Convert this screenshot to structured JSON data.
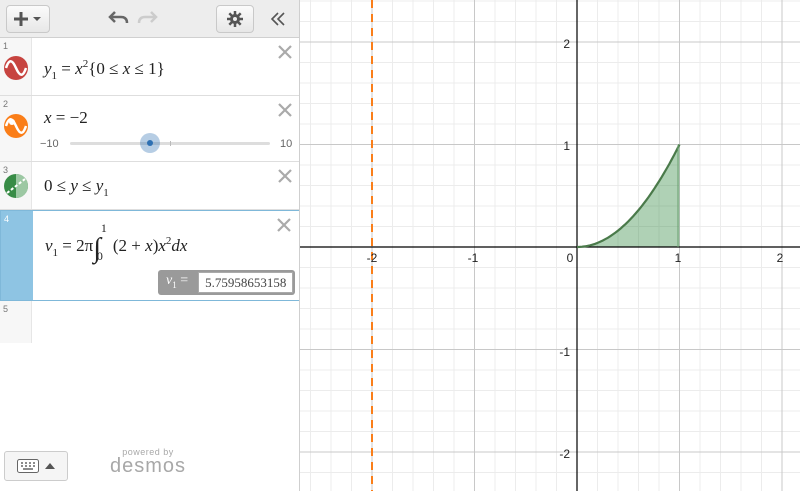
{
  "toolbar": {
    "add_icon": "plus-dropdown-icon",
    "undo_icon": "undo-icon",
    "redo_icon": "redo-icon",
    "settings_icon": "gear-icon",
    "collapse_icon": "double-chevron-left-icon"
  },
  "expressions": [
    {
      "num": "1",
      "color": "#c74440",
      "icon": "wave-icon"
    },
    {
      "num": "2",
      "color": "#fa7e19",
      "icon": "slider-play-icon",
      "slider": {
        "min": "−10",
        "max": "10",
        "value": -2,
        "fraction": 0.4
      }
    },
    {
      "num": "3",
      "color": "#388c46",
      "icon": "inequality-icon"
    },
    {
      "num": "4",
      "eval_label": "v",
      "eval_sub": "1",
      "eval_eq": "=",
      "eval_value": "5.75958653158"
    },
    {
      "num": "5"
    }
  ],
  "math": {
    "e1": {
      "y": "y",
      "sub": "1",
      "eq": " = ",
      "x": "x",
      "exp": "2",
      "open": "{0 ≤ ",
      "x2": "x",
      "close": " ≤ 1}"
    },
    "e2": {
      "x": "x",
      "rest": " = −2"
    },
    "e3": {
      "a": "0 ≤ ",
      "y": "y",
      "mid": " ≤ ",
      "y1": "y",
      "sub": "1"
    },
    "e4": {
      "v": "v",
      "sub": "1",
      "eq": " = 2π",
      "int": "∫",
      "upper": "1",
      "lower": "0",
      "body": "(2 + ",
      "x": "x",
      "body2": ")",
      "x2": "x",
      "exp": "2",
      "d": "dx"
    }
  },
  "footer": {
    "powered": "powered by",
    "brand": "desmos",
    "keyboard_icon": "keyboard-icon"
  },
  "graph": {
    "x_ticks": [
      "-2",
      "-1",
      "0",
      "1",
      "2"
    ],
    "y_ticks": [
      "2",
      "1",
      "-1",
      "-2"
    ],
    "vertical_line_x": -2,
    "curve": "y = x^2 for 0 ≤ x ≤ 1, shaded 0 ≤ y ≤ x^2",
    "colors": {
      "line": "#fa7e19",
      "fill": "#388c46"
    }
  }
}
